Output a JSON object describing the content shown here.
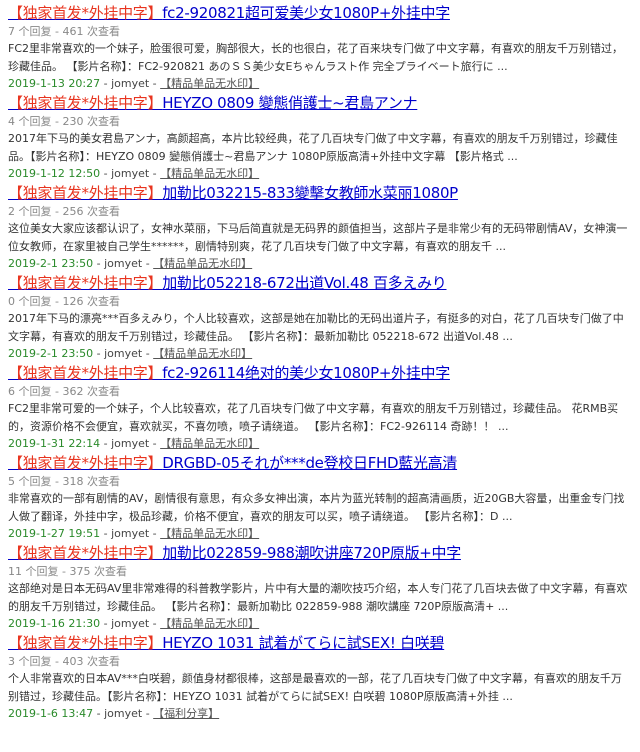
{
  "results": [
    {
      "prefix": "【独家首发*外挂中字】",
      "title": "fc2-920821超可爱美少女1080P+外挂中字",
      "meta": "7 个回复 - 461 次查看",
      "desc": "FC2里非常喜欢的一个妹子，脸蛋很可爱，胸部很大，长的也很白，花了百来块专门做了中文字幕，有喜欢的朋友千万别错过，珍藏佳品。 【影片名称】：FC2-920821 あのＳＳ美少女Eちゃんラスト作 完全プライベート旅行に ...",
      "date": "2019-1-13 20:27",
      "user": "jomyet",
      "tag": "【精品单品无水印】"
    },
    {
      "prefix": "【独家首发*外挂中字】",
      "title": "HEYZO 0809 變態俏護士~君島アンナ",
      "meta": "4 个回复 - 230 次查看",
      "desc": "2017年下马的美女君島アンナ，高颜超高，本片比较经典，花了几百块专门做了中文字幕，有喜欢的朋友千万别错过，珍藏佳品。【影片名称】：HEYZO 0809 變態俏護士~君島アンナ 1080P原版高清+外挂中文字幕 【影片格式 ...",
      "date": "2019-1-12 12:50",
      "user": "jomyet",
      "tag": "【精品单品无水印】"
    },
    {
      "prefix": "【独家首发*外挂中字】",
      "title": "加勒比032215-833變擊女教師水菜丽1080P",
      "meta": "2 个回复 - 256 次查看",
      "desc": "这位美女大家应该都认识了，女神水菜丽，下马后简直就是无码界的颜值担当，这部片子是非常少有的无码带剧情AV，女神演一位女教师，在家里被自己学生******，剧情特别爽，花了几百块专门做了中文字幕，有喜欢的朋友千 ...",
      "date": "2019-2-1 23:50",
      "user": "jomyet",
      "tag": "【精品单品无水印】"
    },
    {
      "prefix": "【独家首发*外挂中字】",
      "title": "加勒比052218-672出道Vol.48 百多えみり",
      "meta": "0 个回复 - 126 次查看",
      "desc": "2017年下马的漂亮***百多えみり，个人比较喜欢，这部是她在加勒比的无码出道片子，有挺多的对白，花了几百块专门做了中文字幕，有喜欢的朋友千万别错过，珍藏佳品。 【影片名称】：最新加勒比 052218-672 出道Vol.48 ...",
      "date": "2019-2-1 23:50",
      "user": "jomyet",
      "tag": "【精品单品无水印】"
    },
    {
      "prefix": "【独家首发*外挂中字】",
      "title": "fc2-926114绝对的美少女1080P+外挂中字",
      "meta": "6 个回复 - 362 次查看",
      "desc": "FC2里非常可爱的一个妹子，个人比较喜欢，花了几百块专门做了中文字幕，有喜欢的朋友千万别错过，珍藏佳品。 花RMB买的，资源价格不会便宜，喜欢就买，不喜勿喷，喷子请绕道。 【影片名称】：FC2-926114 奇跡！！ ...",
      "date": "2019-1-31 22:14",
      "user": "jomyet",
      "tag": "【精品单品无水印】"
    },
    {
      "prefix": "【独家首发*外挂中字】",
      "title": "DRGBD-05それが***de登校日FHD藍光高清",
      "meta": "5 个回复 - 318 次查看",
      "desc": "非常喜欢的一部有剧情的AV，剧情很有意思，有众多女神出演，本片为蓝光转制的超高清画质，近20GB大容量，出重金专门找人做了翻译，外挂中字，极品珍藏，价格不便宜，喜欢的朋友可以买，喷子请绕道。 【影片名称】：D ...",
      "date": "2019-1-27 19:51",
      "user": "jomyet",
      "tag": "【精品单品无水印】"
    },
    {
      "prefix": "【独家首发*外挂中字】",
      "title": "加勒比022859-988潮吹讲座720P原版+中字",
      "meta": "11 个回复 - 375 次查看",
      "desc": "这部绝对是日本无码AV里非常难得的科普教学影片，片中有大量的潮吹技巧介绍，本人专门花了几百块去做了中文字幕，有喜欢的朋友千万别错过，珍藏佳品。 【影片名称】：最新加勒比 022859-988 潮吹講座 720P原版高清+ ...",
      "date": "2019-1-16 21:30",
      "user": "jomyet",
      "tag": "【精品单品无水印】"
    },
    {
      "prefix": "【独家首发*外挂中字】",
      "title": "HEYZO 1031 試着がてらに試SEX! 白咲碧",
      "meta": "3 个回复 - 403 次查看",
      "desc": "个人非常喜欢的日本AV***白咲碧，颜值身材都很棒，这部是最喜欢的一部，花了几百块专门做了中文字幕，有喜欢的朋友千万别错过，珍藏佳品。【影片名称】：HEYZO 1031 試着がてらに試SEX! 白咲碧 1080P原版高清+外挂 ...",
      "date": "2019-1-6 13:47",
      "user": "jomyet",
      "tag": "【福利分享】"
    }
  ]
}
